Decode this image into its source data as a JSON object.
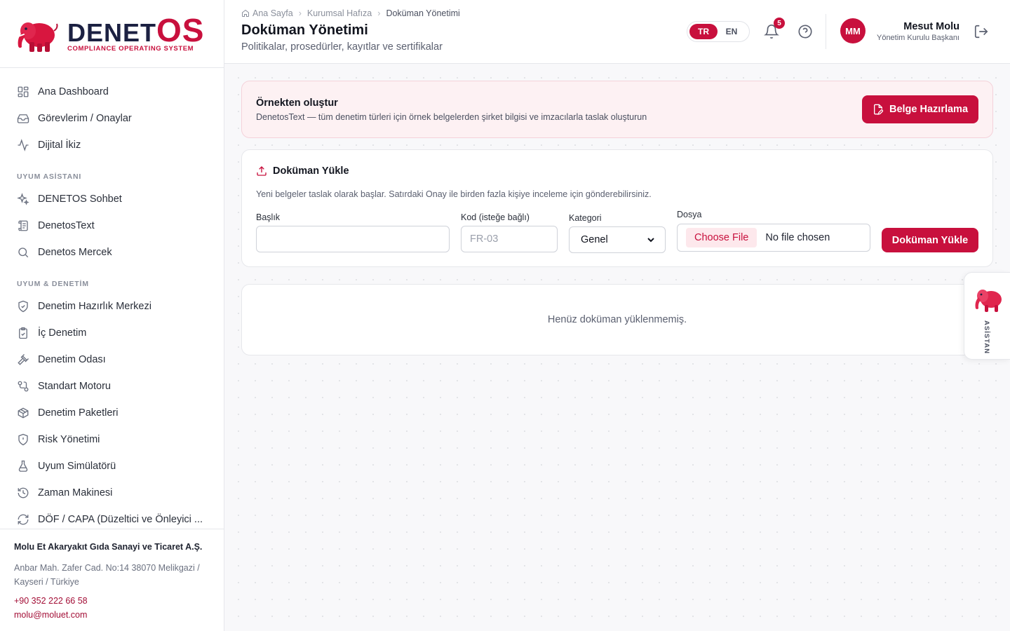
{
  "brand": {
    "name_main": "DENET",
    "name_accent": "OS",
    "tagline": "COMPLIANCE OPERATING SYSTEM",
    "accent_color": "#c8103d"
  },
  "sidebar": {
    "items_top": [
      {
        "label": "Ana Dashboard",
        "icon": "dashboard-grid-icon"
      },
      {
        "label": "Görevlerim / Onaylar",
        "icon": "inbox-icon"
      },
      {
        "label": "Dijital İkiz",
        "icon": "activity-icon"
      }
    ],
    "section_1": "UYUM ASİSTANI",
    "items_assistant": [
      {
        "label": "DENETOS Sohbet",
        "icon": "sparkles-icon"
      },
      {
        "label": "DenetosText",
        "icon": "scroll-text-icon"
      },
      {
        "label": "Denetos Mercek",
        "icon": "search-icon"
      }
    ],
    "section_2": "UYUM & DENETİM",
    "items_audit": [
      {
        "label": "Denetim Hazırlık Merkezi",
        "icon": "shield-check-icon"
      },
      {
        "label": "İç Denetim",
        "icon": "clipboard-check-icon"
      },
      {
        "label": "Denetim Odası",
        "icon": "gavel-icon"
      },
      {
        "label": "Standart Motoru",
        "icon": "workflow-icon"
      },
      {
        "label": "Denetim Paketleri",
        "icon": "package-icon"
      },
      {
        "label": "Risk Yönetimi",
        "icon": "shield-alert-icon"
      },
      {
        "label": "Uyum Simülatörü",
        "icon": "flask-icon"
      },
      {
        "label": "Zaman Makinesi",
        "icon": "history-icon"
      },
      {
        "label": "DÖF / CAPA (Düzeltici ve Önleyici ...",
        "icon": "refresh-icon"
      }
    ],
    "company": {
      "name": "Molu Et Akaryakıt Gıda Sanayi ve Ticaret A.Ş.",
      "address": "Anbar Mah. Zafer Cad. No:14 38070 Melikgazi / Kayseri / Türkiye",
      "phone": "+90 352 222 66 58",
      "email": "molu@moluet.com"
    }
  },
  "header": {
    "breadcrumb": [
      "Ana Sayfa",
      "Kurumsal Hafıza",
      "Doküman Yönetimi"
    ],
    "title": "Doküman Yönetimi",
    "subtitle": "Politikalar, prosedürler, kayıtlar ve sertifikalar",
    "lang_tr": "TR",
    "lang_en": "EN",
    "notification_count": "5",
    "user": {
      "initials": "MM",
      "name": "Mesut Molu",
      "role": "Yönetim Kurulu Başkanı"
    }
  },
  "banner": {
    "title": "Örnekten oluştur",
    "description": "DenetosText — tüm denetim türleri için örnek belgelerden şirket bilgisi ve imzacılarla taslak oluşturun",
    "button": "Belge Hazırlama"
  },
  "upload": {
    "title": "Doküman Yükle",
    "description": "Yeni belgeler taslak olarak başlar. Satırdaki Onay ile birden fazla kişiye inceleme için gönderebilirsiniz.",
    "title_label": "Başlık",
    "title_value": "",
    "code_label": "Kod (isteğe bağlı)",
    "code_placeholder": "FR-03",
    "category_label": "Kategori",
    "category_value": "Genel",
    "file_label": "Dosya",
    "choose_file": "Choose File",
    "no_file": "No file chosen",
    "submit": "Doküman Yükle"
  },
  "empty_state": "Henüz doküman yüklenmemiş.",
  "assistant": {
    "label": "ASİSTAN"
  }
}
